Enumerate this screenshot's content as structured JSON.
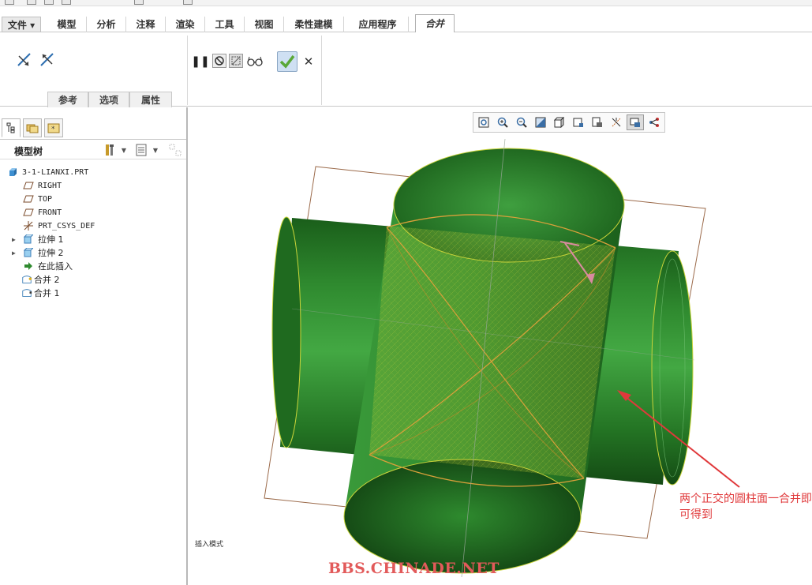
{
  "tabs": {
    "file": "文件",
    "items": [
      "模型",
      "分析",
      "注释",
      "渲染",
      "工具",
      "视图",
      "柔性建模",
      "应用程序"
    ],
    "active": "合并"
  },
  "ribbon": {
    "sub_tabs": [
      "参考",
      "选项",
      "属性"
    ],
    "confirm_color": "#5aa838"
  },
  "model_tree": {
    "title": "模型树",
    "items": [
      {
        "label": "3-1-LIANXI.PRT",
        "icon": "part-icon"
      },
      {
        "label": "RIGHT",
        "icon": "datum-plane-icon"
      },
      {
        "label": "TOP",
        "icon": "datum-plane-icon"
      },
      {
        "label": "FRONT",
        "icon": "datum-plane-icon"
      },
      {
        "label": "PRT_CSYS_DEF",
        "icon": "csys-icon"
      },
      {
        "label": "拉伸 1",
        "icon": "extrude-icon"
      },
      {
        "label": "拉伸 2",
        "icon": "extrude-icon"
      },
      {
        "label": "在此插入",
        "icon": "insert-arrow-icon"
      },
      {
        "label": "合并 2",
        "icon": "merge-icon"
      },
      {
        "label": "合并 1",
        "icon": "merge-icon"
      }
    ]
  },
  "graphics": {
    "status_text": "插入模式",
    "annotation": "两个正交的圆柱面一合并即可得到",
    "watermark": "BBS.CHINADE.NET",
    "model_color": "#2f8a2f",
    "highlight_color": "#c9d43a",
    "annotation_color": "#e0393b"
  }
}
